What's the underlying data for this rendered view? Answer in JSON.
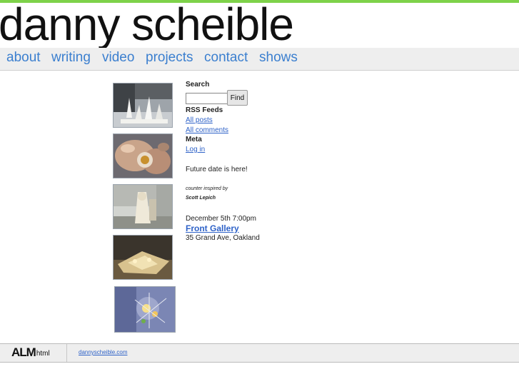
{
  "header": {
    "site_title": "danny scheible"
  },
  "nav": {
    "items": [
      {
        "label": "about"
      },
      {
        "label": "writing"
      },
      {
        "label": "video"
      },
      {
        "label": "projects"
      },
      {
        "label": "contact"
      },
      {
        "label": "shows"
      }
    ]
  },
  "sidebar": {
    "search_heading": "Search",
    "search_value": "",
    "find_label": "Find",
    "rss_heading": "RSS Feeds",
    "all_posts": "All posts",
    "all_comments": "All comments",
    "meta_heading": "Meta",
    "log_in": "Log in",
    "announcement": "Future date is here!",
    "counter_note": "counter inspired by",
    "counter_author": "Scott Lepich",
    "event_date": "December 5th 7:00pm",
    "event_venue": "Front Gallery",
    "event_address": "35 Grand Ave, Oakland"
  },
  "thumbnails": [
    {
      "name": "sculpture-photo-1"
    },
    {
      "name": "sculpture-photo-2"
    },
    {
      "name": "sculpture-photo-3"
    },
    {
      "name": "sculpture-photo-4"
    },
    {
      "name": "sculpture-photo-5"
    }
  ],
  "footer": {
    "logo_main": "ALM",
    "logo_sub": "html",
    "link": "dannyscheible.com"
  },
  "colors": {
    "accent_bar": "#7ed24a",
    "nav_link": "#3b7fcf",
    "link": "#2e62c8"
  }
}
